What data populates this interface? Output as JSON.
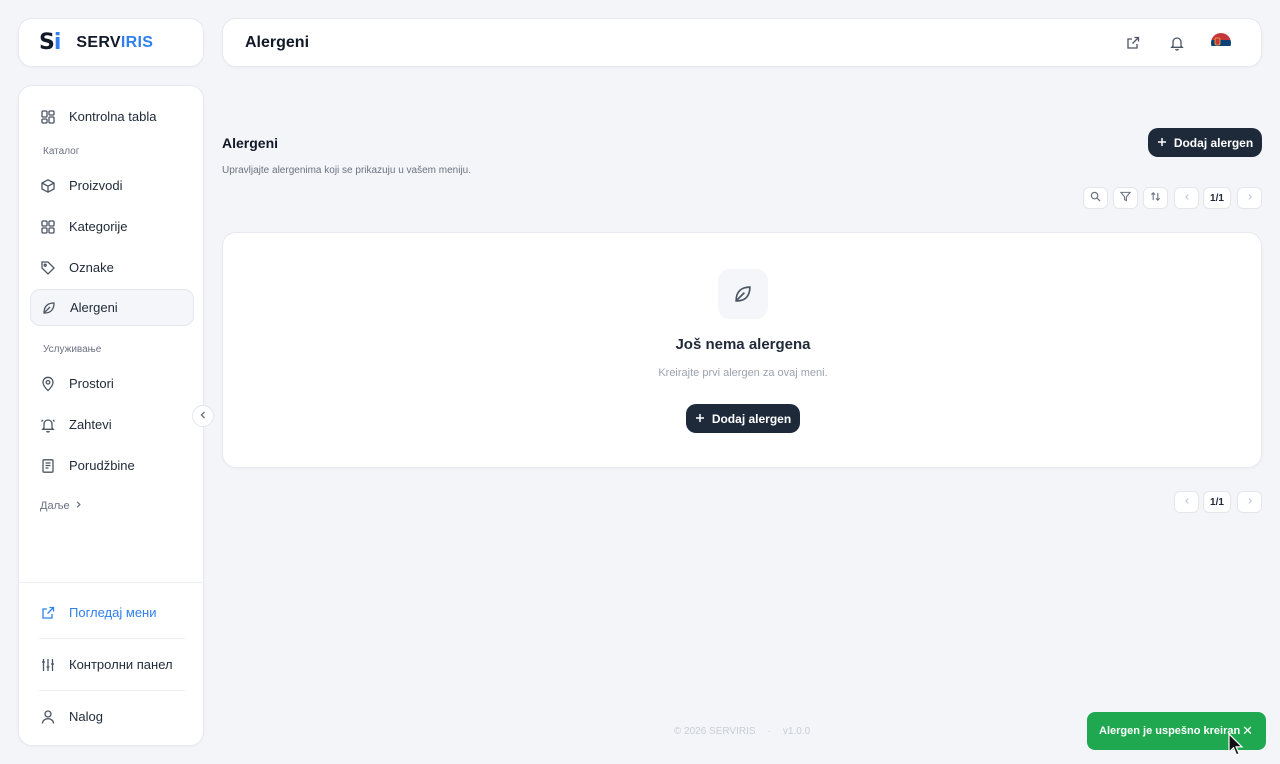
{
  "logo": {
    "mark": "Si",
    "text_a": "SERV",
    "text_b": "IRIS"
  },
  "header": {
    "title": "Alergeni"
  },
  "sidebar": {
    "dashboard": "Kontrolna tabla",
    "section_catalog": "Каталог",
    "items_catalog": [
      "Proizvodi",
      "Kategorije",
      "Oznake",
      "Alergeni"
    ],
    "section_service": "Услуживање",
    "items_service": [
      "Prostori",
      "Zahtevi",
      "Porudžbine"
    ],
    "more": "Даље",
    "view_menu": "Погледај мени",
    "control_panel": "Контролни панел",
    "account": "Nalog"
  },
  "page": {
    "title": "Alergeni",
    "subtitle": "Upravljajte alergenima koji se prikazuju u vašem meniju.",
    "add_button": "Dodaj alergen",
    "pagination_top": "1/1",
    "pagination_bottom": "1/1"
  },
  "empty_state": {
    "title": "Još nema alergena",
    "subtitle": "Kreirajte prvi alergen za ovaj meni.",
    "button": "Dodaj alergen"
  },
  "footer": {
    "copyright": "© 2026 SERVIRIS",
    "separator": "·",
    "version": "v1.0.0"
  },
  "toast": {
    "message": "Alergen je uspešno kreiran",
    "close": "✕"
  },
  "colors": {
    "accent": "#2f80ed",
    "dark_button": "#1e2a3a",
    "toast_success": "#1fa84f",
    "background": "#f3f5f8"
  }
}
